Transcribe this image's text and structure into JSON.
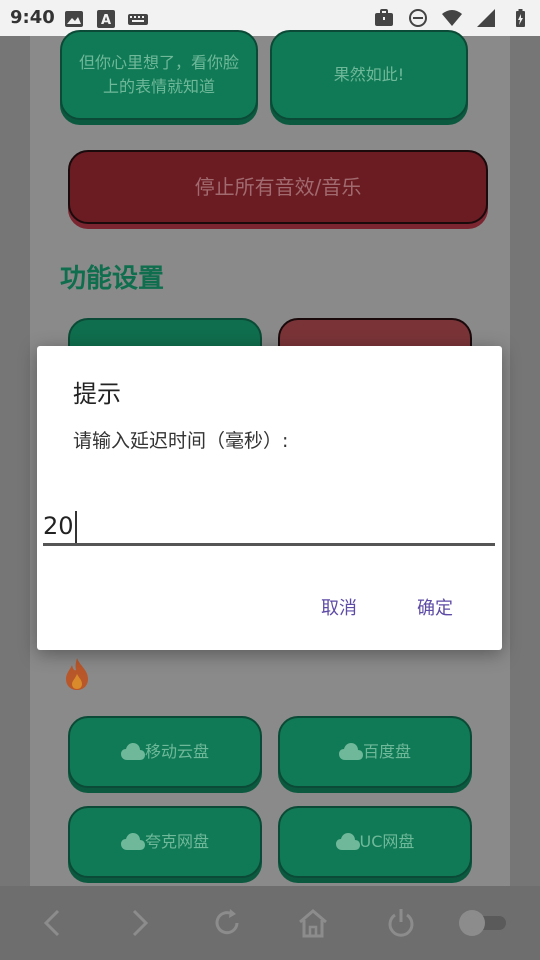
{
  "status_bar": {
    "time": "9:40",
    "left_icons": [
      "image-icon",
      "text-a-icon",
      "keyboard-icon"
    ],
    "right_icons": [
      "briefcase-icon",
      "dnd-icon",
      "wifi-icon",
      "signal-icon",
      "battery-charging-icon"
    ]
  },
  "buttons": {
    "reply_left": "但你心里想了，看你脸上的表情就知道",
    "reply_right": "果然如此!",
    "stop_all": "停止所有音效/音乐",
    "cloud_mobile": "移动云盘",
    "cloud_baidu": "百度盘",
    "cloud_quark": "夸克网盘",
    "cloud_uc": "UC网盘"
  },
  "section": {
    "title": "功能设置"
  },
  "dialog": {
    "title": "提示",
    "message": "请输入延迟时间（毫秒）:",
    "input_value": "20",
    "cancel_label": "取消",
    "ok_label": "确定"
  },
  "colors": {
    "green_button": "#0f7a55",
    "red_button": "#6b1c23",
    "dialog_accent": "#5e4ba6"
  },
  "bottom_nav": {
    "icons": [
      "back-icon",
      "forward-icon",
      "refresh-icon",
      "home-icon",
      "power-icon",
      "toggle-switch"
    ]
  }
}
